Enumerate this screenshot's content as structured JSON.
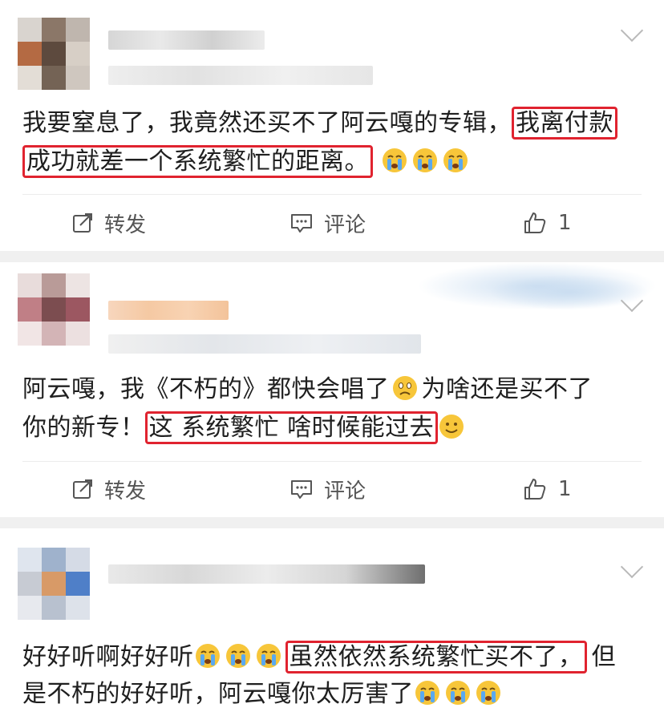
{
  "posts": [
    {
      "text_lines": [
        {
          "plain": "我要窒息了，我竟然还买不了阿云嘎的专辑，",
          "highlight": "我离付款"
        },
        {
          "highlight": "成功就差一个系统繁忙的距离。",
          "emojis": [
            "crying-emoji",
            "crying-emoji",
            "crying-emoji"
          ]
        }
      ],
      "actions": {
        "repost": "转发",
        "comment": "评论",
        "likes": "1"
      }
    },
    {
      "text_lines": [
        {
          "plain": "阿云嘎，我《不朽的》都快会唱了",
          "emoji_mid": "sad-emoji",
          "plain2": "为啥还是买不了"
        },
        {
          "plain": "你的新专！",
          "highlight": "这 系统繁忙 啥时候能过去",
          "emojis": [
            "smile-emoji"
          ]
        }
      ],
      "actions": {
        "repost": "转发",
        "comment": "评论",
        "likes": "1"
      }
    },
    {
      "text_lines": [
        {
          "plain": "好好听啊好好听",
          "emojis": [
            "crying-emoji",
            "crying-emoji",
            "crying-emoji"
          ],
          "highlight": "虽然依然系统繁忙买不了，",
          "plain2": "但"
        },
        {
          "plain": "是不朽的好好听，阿云嘎你太厉害了",
          "emojis": [
            "crying-emoji",
            "crying-emoji",
            "crying-emoji"
          ]
        }
      ]
    }
  ],
  "colors": {
    "highlight_border": "#e0232f",
    "divider": "#f0f0f0",
    "text": "#1f1f1f",
    "action_text": "#555555"
  }
}
